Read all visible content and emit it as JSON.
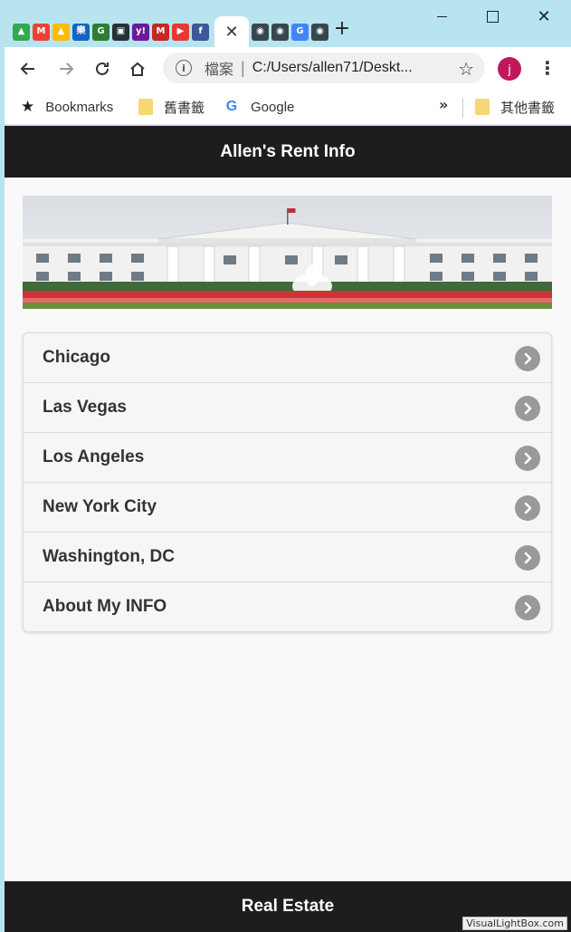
{
  "browser": {
    "favicons": [
      {
        "name": "drive-icon",
        "glyph": "▲",
        "color": "#34a853"
      },
      {
        "name": "gmail-icon",
        "glyph": "M",
        "color": "#ea4335"
      },
      {
        "name": "drive-icon-2",
        "glyph": "▲",
        "color": "#fbbc05"
      },
      {
        "name": "music-icon",
        "glyph": "樂",
        "color": "#1565c0"
      },
      {
        "name": "green-app-icon",
        "glyph": "G",
        "color": "#2e7d32"
      },
      {
        "name": "phone-app-icon",
        "glyph": "▣",
        "color": "#263238"
      },
      {
        "name": "yahoo-icon",
        "glyph": "y!",
        "color": "#6a1b9a"
      },
      {
        "name": "m-app-icon",
        "glyph": "M",
        "color": "#c62828"
      },
      {
        "name": "youtube-icon",
        "glyph": "▶",
        "color": "#e53935"
      },
      {
        "name": "facebook-icon",
        "glyph": "f",
        "color": "#3b5998"
      }
    ],
    "active_tab_glyph": "✕",
    "favicons_after": [
      {
        "name": "chrome-icon",
        "glyph": "◉",
        "color": "#37474f"
      },
      {
        "name": "chrome-icon-2",
        "glyph": "◉",
        "color": "#37474f"
      },
      {
        "name": "translate-icon",
        "glyph": "G",
        "color": "#4285f4"
      },
      {
        "name": "chrome-icon-3",
        "glyph": "◉",
        "color": "#37474f"
      }
    ],
    "new_tab": "+",
    "close_glyph": "✕",
    "address": {
      "scheme_label": "檔案",
      "separator": "|",
      "url": "C:/Users/allen71/Deskt..."
    },
    "profile_initial": "j",
    "bookmarks": {
      "bookmarks_label": "Bookmarks",
      "folder1_label": "舊書籤",
      "google_label": "Google",
      "more": "»",
      "other_label": "其他書籤"
    }
  },
  "app": {
    "header_title": "Allen's Rent Info",
    "footer_title": "Real Estate",
    "list_items": [
      {
        "label": "Chicago"
      },
      {
        "label": "Las Vegas"
      },
      {
        "label": "Los Angeles"
      },
      {
        "label": "New York City"
      },
      {
        "label": "Washington, DC"
      },
      {
        "label": "About My INFO"
      }
    ]
  },
  "watermark": "VisualLightBox.com"
}
